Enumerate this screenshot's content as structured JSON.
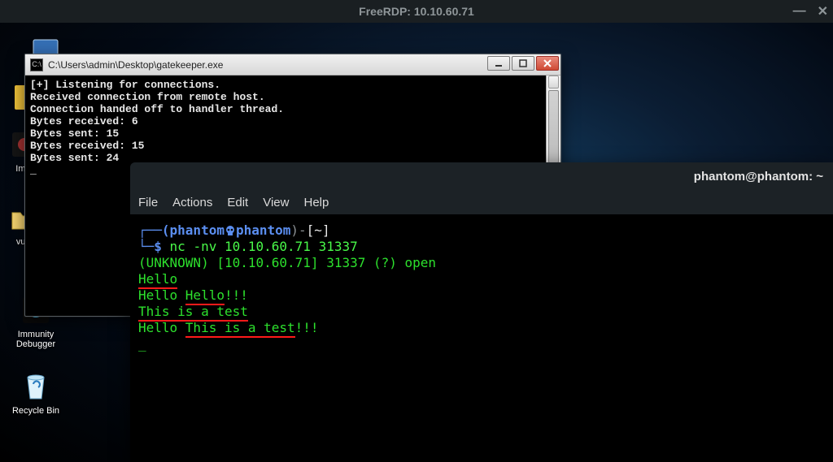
{
  "host_titlebar": {
    "title": "FreeRDP: 10.10.60.71"
  },
  "desktop": {
    "icons": [
      {
        "label": ""
      },
      {
        "label": ""
      },
      {
        "label": "Imm"
      },
      {
        "label": ""
      },
      {
        "label": "vuln"
      },
      {
        "label": "Immunity Debugger"
      },
      {
        "label": "Recycle Bin"
      }
    ]
  },
  "win_console": {
    "title": "C:\\Users\\admin\\Desktop\\gatekeeper.exe",
    "output": "[+] Listening for connections.\nReceived connection from remote host.\nConnection handed off to handler thread.\nBytes received: 6\nBytes sent: 15\nBytes received: 15\nBytes sent: 24\n_"
  },
  "term": {
    "title": "phantom@phantom: ~",
    "menu": [
      "File",
      "Actions",
      "Edit",
      "View",
      "Help"
    ],
    "ps1": {
      "open": "┌──(",
      "user": "phantom",
      "sep_icon": "skull",
      "host": "phantom",
      "close": ")-",
      "cwd": "[~]",
      "line2_prefix": "└─",
      "prompt": "$"
    },
    "command": "nc -nv 10.10.60.71 31337",
    "lines": [
      {
        "segments": [
          {
            "text": "(UNKNOWN) [10.10.60.71] 31337 (?) open",
            "cls": "c-green"
          }
        ]
      },
      {
        "segments": [
          {
            "text": "Hello",
            "cls": "c-green ul-red"
          }
        ]
      },
      {
        "segments": [
          {
            "text": "Hello ",
            "cls": "c-green"
          },
          {
            "text": "Hello",
            "cls": "c-green ul-red"
          },
          {
            "text": "!!!",
            "cls": "c-green"
          }
        ]
      },
      {
        "segments": [
          {
            "text": "This is a test",
            "cls": "c-green ul-red"
          }
        ]
      },
      {
        "segments": [
          {
            "text": "Hello ",
            "cls": "c-green"
          },
          {
            "text": "This is a test",
            "cls": "c-green ul-red"
          },
          {
            "text": "!!!",
            "cls": "c-green"
          }
        ]
      },
      {
        "segments": [
          {
            "text": " ",
            "cls": ""
          }
        ]
      },
      {
        "segments": [
          {
            "text": "_",
            "cls": "c-green"
          }
        ]
      }
    ]
  }
}
